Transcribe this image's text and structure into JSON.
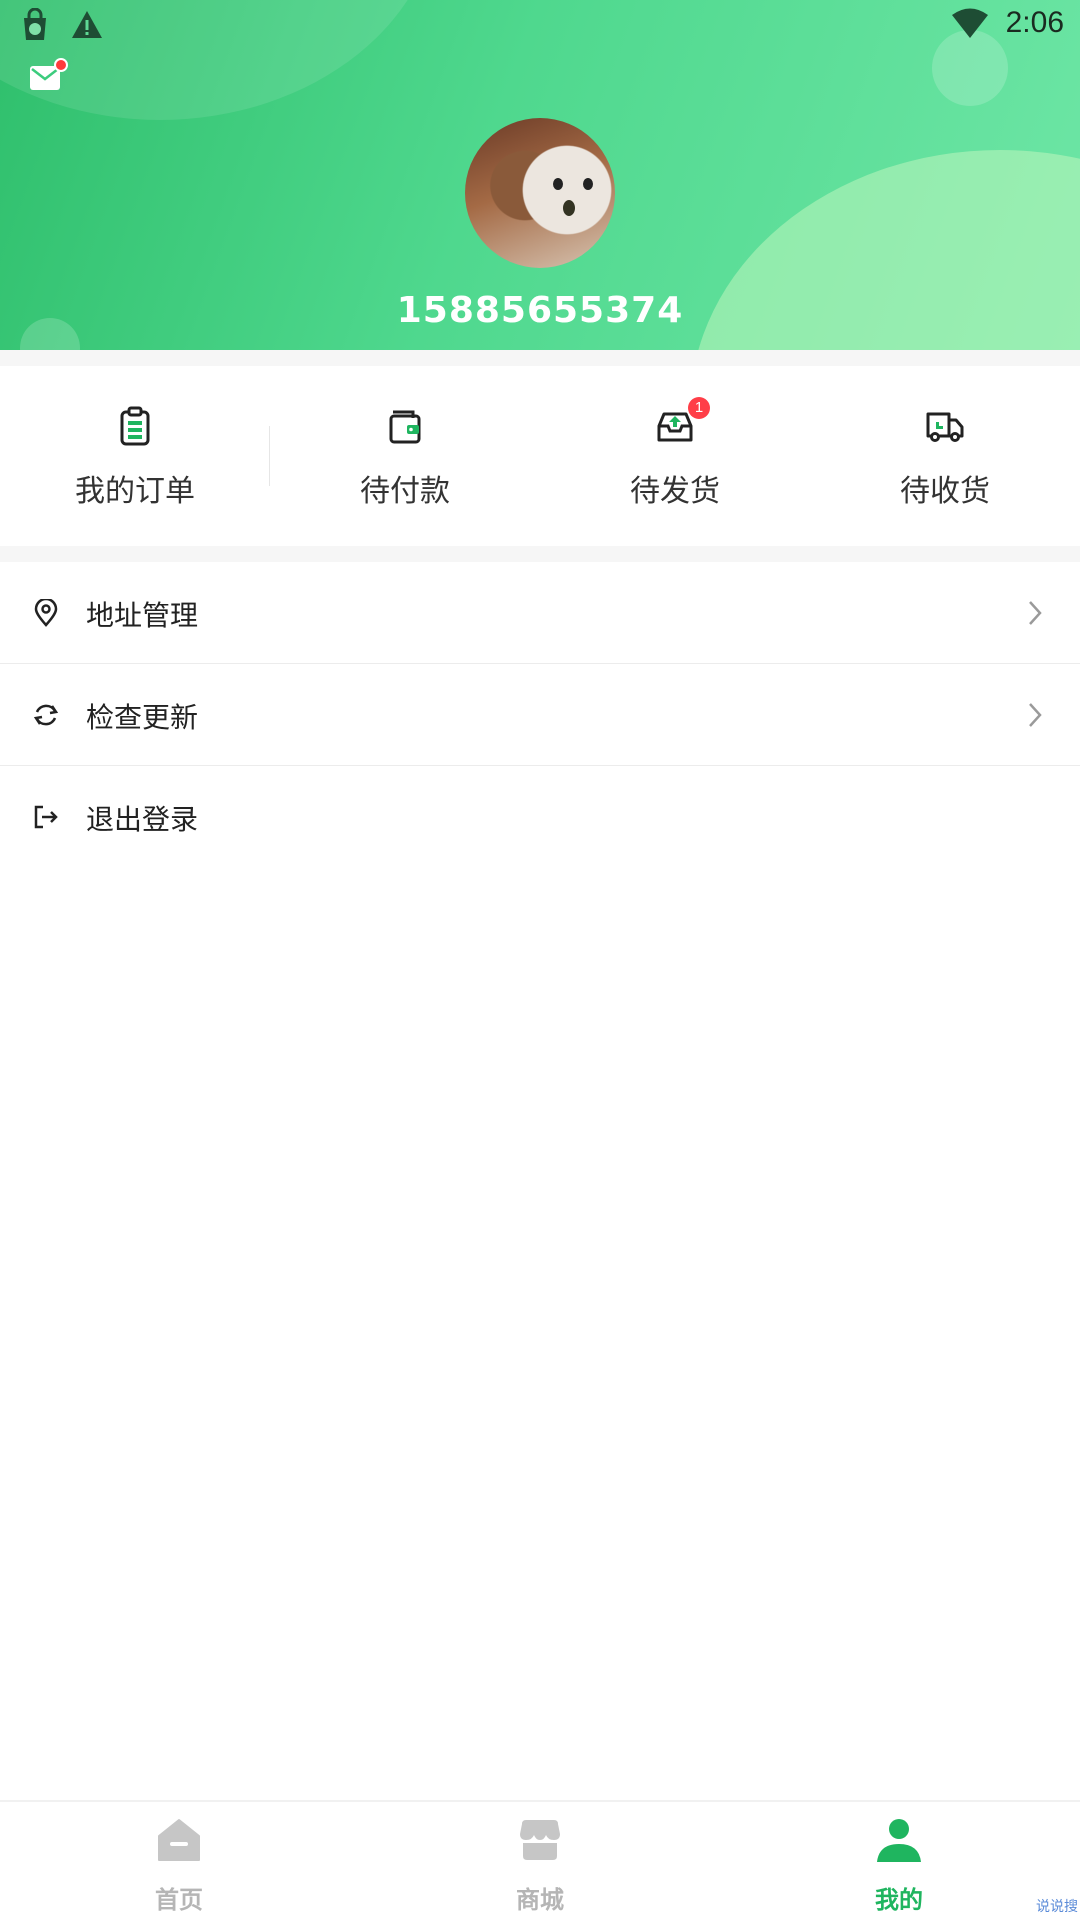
{
  "status_bar": {
    "time": "2:06",
    "icons": [
      "app-store-icon",
      "warning-icon",
      "wifi-icon"
    ]
  },
  "header": {
    "phone": "15885655374",
    "mail_icon": "mail-icon",
    "has_unread": true
  },
  "orders": {
    "items": [
      {
        "label": "我的订单",
        "icon": "clipboard-icon"
      },
      {
        "label": "待付款",
        "icon": "wallet-icon"
      },
      {
        "label": "待发货",
        "icon": "outbox-icon",
        "badge": "1"
      },
      {
        "label": "待收货",
        "icon": "truck-icon"
      }
    ]
  },
  "menu": {
    "items": [
      {
        "label": "地址管理",
        "icon": "location-pin-icon",
        "has_arrow": true
      },
      {
        "label": "检查更新",
        "icon": "refresh-icon",
        "has_arrow": true
      },
      {
        "label": "退出登录",
        "icon": "logout-icon",
        "has_arrow": false
      }
    ]
  },
  "bottom_nav": {
    "items": [
      {
        "label": "首页",
        "icon": "home-icon",
        "active": false
      },
      {
        "label": "商城",
        "icon": "shop-icon",
        "active": false
      },
      {
        "label": "我的",
        "icon": "user-icon",
        "active": true
      }
    ]
  },
  "colors": {
    "accent": "#1fb55f",
    "header_start": "#2fbf6c",
    "header_end": "#6ee6a6",
    "badge": "#ff3e48",
    "inactive": "#b5b5b5"
  },
  "watermark": "说说搜"
}
